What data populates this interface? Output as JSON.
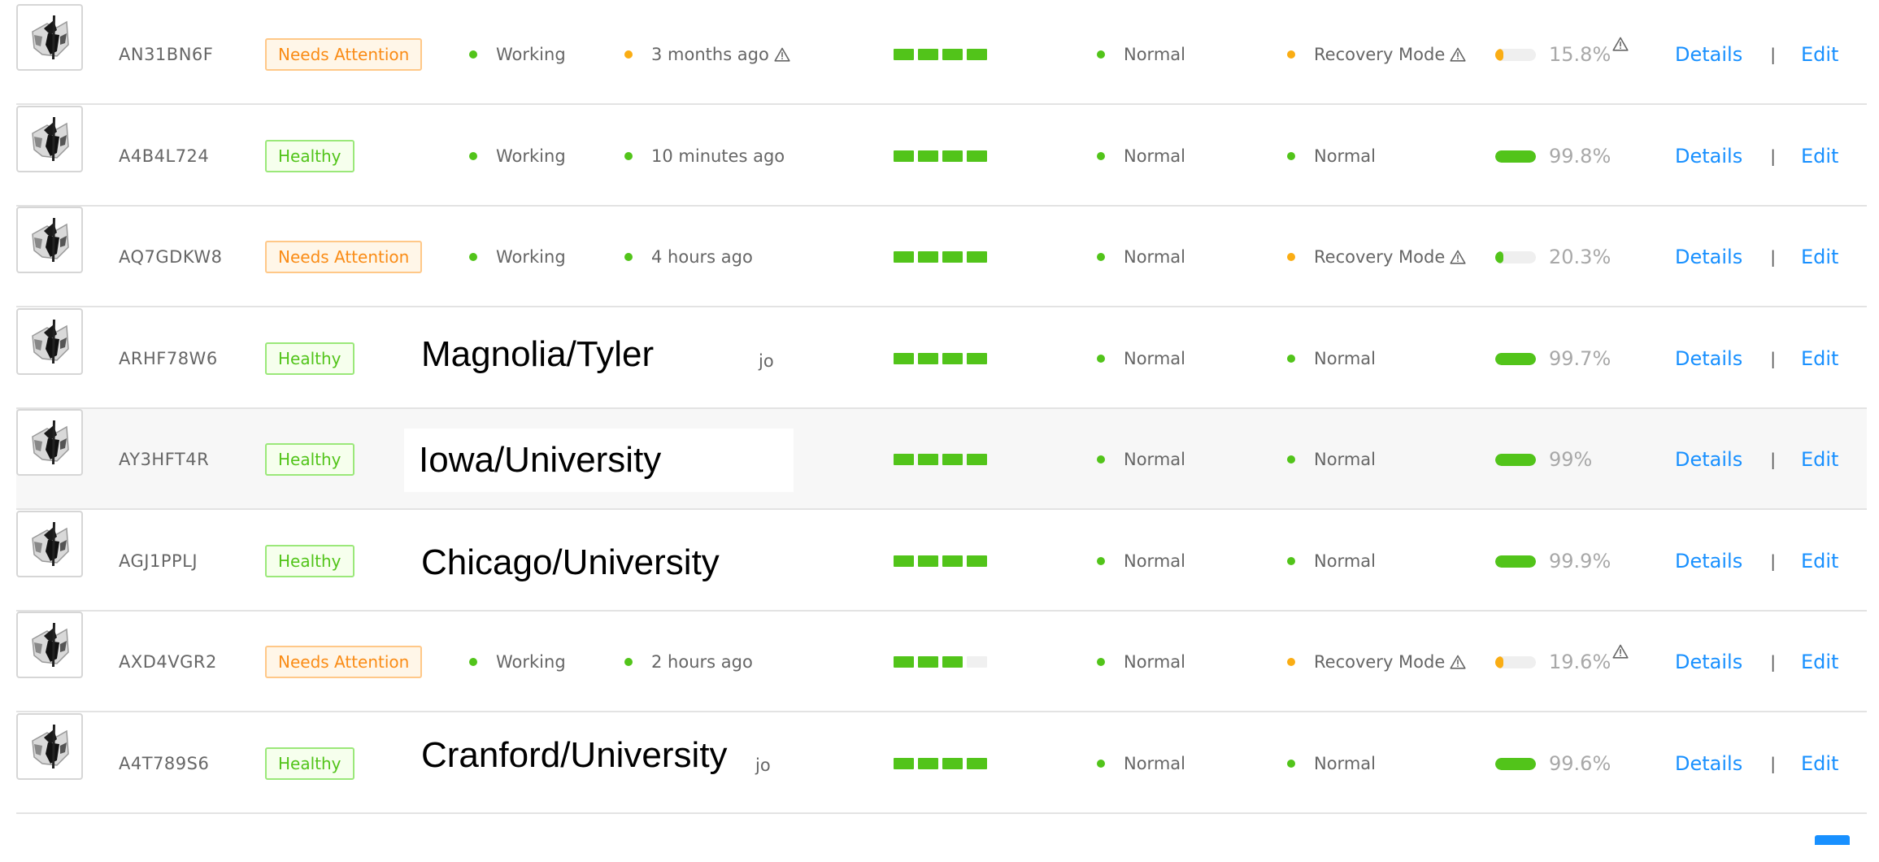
{
  "colors": {
    "green": "#52c41a",
    "orange": "#faad14",
    "link": "#1890ff",
    "attention": "#fa8c16"
  },
  "columns": {
    "signal_segments": 4
  },
  "links": {
    "details": "Details",
    "separator": "|",
    "edit": "Edit"
  },
  "rows": [
    {
      "serial": "AN31BN6F",
      "badge": "Needs Attention",
      "badge_type": "attention",
      "status": "Working",
      "last_seen": "3 months ago",
      "last_seen_dot": "orange",
      "last_seen_warning": true,
      "signal_bars": 4,
      "health": "Normal",
      "mode": "Recovery Mode",
      "mode_dot": "orange",
      "mode_warning": true,
      "battery": "15.8%",
      "battery_level": 0.158,
      "battery_color": "orange",
      "battery_warning": true
    },
    {
      "serial": "A4B4L724",
      "badge": "Healthy",
      "badge_type": "healthy",
      "status": "Working",
      "last_seen": "10 minutes ago",
      "last_seen_dot": "green",
      "last_seen_warning": false,
      "signal_bars": 4,
      "health": "Normal",
      "mode": "Normal",
      "mode_dot": "green",
      "mode_warning": false,
      "battery": "99.8%",
      "battery_level": 0.998,
      "battery_color": "green",
      "battery_warning": false
    },
    {
      "serial": "AQ7GDKW8",
      "badge": "Needs Attention",
      "badge_type": "attention",
      "status": "Working",
      "last_seen": "4 hours ago",
      "last_seen_dot": "green",
      "last_seen_warning": false,
      "signal_bars": 4,
      "health": "Normal",
      "mode": "Recovery Mode",
      "mode_dot": "orange",
      "mode_warning": true,
      "battery": "20.3%",
      "battery_level": 0.203,
      "battery_color": "green",
      "battery_warning": false
    },
    {
      "serial": "ARHF78W6",
      "badge": "Healthy",
      "badge_type": "healthy",
      "overlay_label": "Magnolia/Tyler",
      "partial_text": "jo",
      "signal_bars": 4,
      "health": "Normal",
      "mode": "Normal",
      "mode_dot": "green",
      "mode_warning": false,
      "battery": "99.7%",
      "battery_level": 0.997,
      "battery_color": "green",
      "battery_warning": false
    },
    {
      "serial": "AY3HFT4R",
      "badge": "Healthy",
      "badge_type": "healthy",
      "highlighted": true,
      "overlay_label": "Iowa/University",
      "signal_bars": 4,
      "health": "Normal",
      "mode": "Normal",
      "mode_dot": "green",
      "mode_warning": false,
      "battery": "99%",
      "battery_level": 0.99,
      "battery_color": "green",
      "battery_warning": false
    },
    {
      "serial": "AGJ1PPLJ",
      "badge": "Healthy",
      "badge_type": "healthy",
      "overlay_label": "Chicago/University",
      "signal_bars": 4,
      "health": "Normal",
      "mode": "Normal",
      "mode_dot": "green",
      "mode_warning": false,
      "battery": "99.9%",
      "battery_level": 0.999,
      "battery_color": "green",
      "battery_warning": false
    },
    {
      "serial": "AXD4VGR2",
      "badge": "Needs Attention",
      "badge_type": "attention",
      "status": "Working",
      "last_seen": "2 hours ago",
      "last_seen_dot": "green",
      "last_seen_warning": false,
      "signal_bars": 3,
      "health": "Normal",
      "mode": "Recovery Mode",
      "mode_dot": "orange",
      "mode_warning": true,
      "battery": "19.6%",
      "battery_level": 0.196,
      "battery_color": "orange",
      "battery_warning": true
    },
    {
      "serial": "A4T789S6",
      "badge": "Healthy",
      "badge_type": "healthy",
      "overlay_label": "Cranford/University",
      "partial_text": "jo",
      "signal_bars": 4,
      "health": "Normal",
      "mode": "Normal",
      "mode_dot": "green",
      "mode_warning": false,
      "battery": "99.6%",
      "battery_level": 0.996,
      "battery_color": "green",
      "battery_warning": false
    }
  ]
}
